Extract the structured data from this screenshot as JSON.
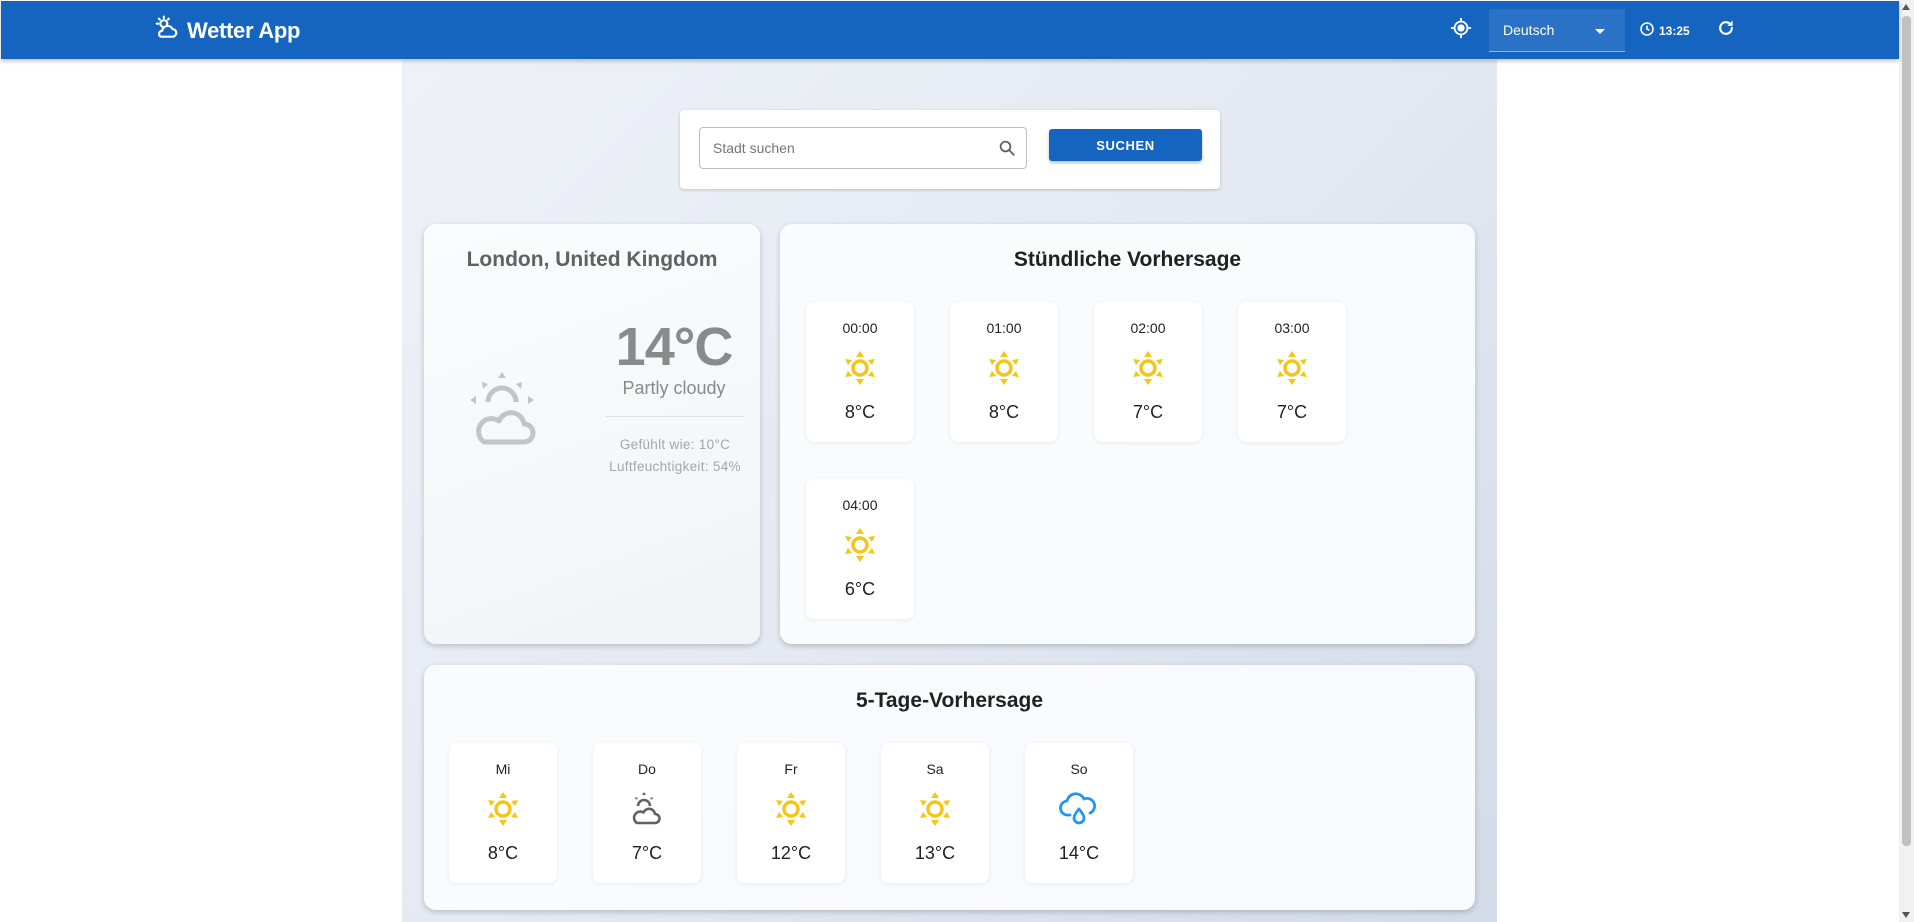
{
  "appbar": {
    "title": "Wetter App",
    "language": "Deutsch",
    "time": "13:25",
    "color": "#1565c0"
  },
  "search": {
    "placeholder": "Stadt suchen",
    "value": "",
    "button_label": "SUCHEN"
  },
  "current": {
    "location": "London, United Kingdom",
    "temperature": "14°C",
    "description": "Partly cloudy",
    "feels_like": "Gefühlt wie: 10°C",
    "humidity": "Luftfeuchtigkeit: 54%",
    "icon": "partly-cloudy-icon"
  },
  "hourly": {
    "title": "Stündliche Vorhersage",
    "items": [
      {
        "time": "00:00",
        "temp": "8°C",
        "icon": "sun-icon"
      },
      {
        "time": "01:00",
        "temp": "8°C",
        "icon": "sun-icon"
      },
      {
        "time": "02:00",
        "temp": "7°C",
        "icon": "sun-icon"
      },
      {
        "time": "03:00",
        "temp": "7°C",
        "icon": "sun-icon"
      },
      {
        "time": "04:00",
        "temp": "6°C",
        "icon": "sun-icon"
      }
    ]
  },
  "daily": {
    "title": "5-Tage-Vorhersage",
    "items": [
      {
        "day": "Mi",
        "temp": "8°C",
        "icon": "sun-icon"
      },
      {
        "day": "Do",
        "temp": "7°C",
        "icon": "partly-cloudy-icon"
      },
      {
        "day": "Fr",
        "temp": "12°C",
        "icon": "sun-icon"
      },
      {
        "day": "Sa",
        "temp": "13°C",
        "icon": "sun-icon"
      },
      {
        "day": "So",
        "temp": "14°C",
        "icon": "rain-cloud-icon"
      }
    ]
  },
  "colors": {
    "sun": "#f5c518",
    "rain": "#2196f3",
    "cloud_grey": "#616161"
  }
}
